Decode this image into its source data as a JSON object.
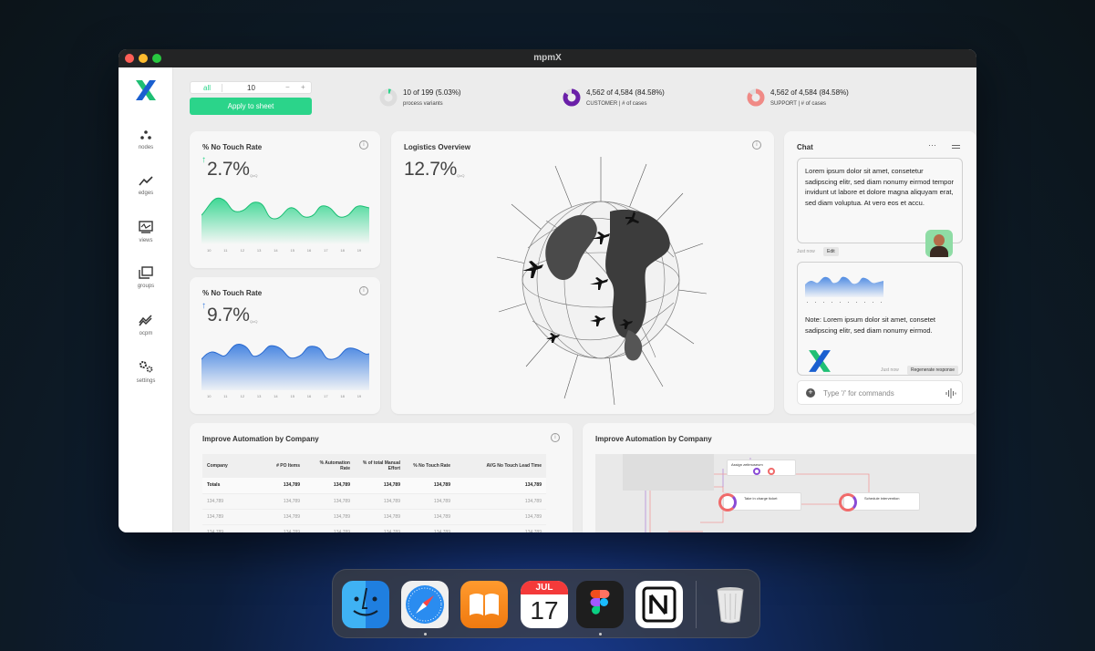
{
  "window": {
    "title": "mpmX"
  },
  "sidebar": {
    "items": [
      {
        "label": "nodes",
        "icon": "nodes-icon"
      },
      {
        "label": "edges",
        "icon": "edges-icon"
      },
      {
        "label": "views",
        "icon": "views-icon"
      },
      {
        "label": "groups",
        "icon": "groups-icon"
      },
      {
        "label": "ocpm",
        "icon": "ocpm-icon"
      },
      {
        "label": "settings",
        "icon": "settings-icon"
      }
    ]
  },
  "toolbar": {
    "all_label": "all",
    "count_value": "10",
    "minus": "−",
    "plus": "+",
    "apply_label": "Apply to sheet"
  },
  "stats": [
    {
      "line1": "10 of 199 (5.03%)",
      "line2": "process variants",
      "ring_color": "#2bd48a",
      "percent": 5.03
    },
    {
      "line1": "4,562 of 4,584 (84.58%)",
      "line2": "CUSTOMER | # of cases",
      "ring_color": "#6a1fa8",
      "percent": 84.58
    },
    {
      "line1": "4,562 of 4,584 (84.58%)",
      "line2": "SUPPORT | # of cases",
      "ring_color": "#f08a86",
      "percent": 84.58
    }
  ],
  "kpi_cards": [
    {
      "title": "% No Touch Rate",
      "value": "2.7%",
      "qoq": "QoQ",
      "color": "#2bd48a",
      "ticks": [
        "10",
        "11",
        "12",
        "13",
        "14",
        "15",
        "16",
        "17",
        "18",
        "19"
      ]
    },
    {
      "title": "% No Touch Rate",
      "value": "9.7%",
      "qoq": "QoQ",
      "color": "#3d7fe0",
      "ticks": [
        "10",
        "11",
        "12",
        "13",
        "14",
        "15",
        "16",
        "17",
        "18",
        "19"
      ]
    }
  ],
  "logistics": {
    "title": "Logistics Overview",
    "value": "12.7%",
    "qoq": "QoQ"
  },
  "chat": {
    "title": "Chat",
    "message1": "Lorem ipsum dolor sit amet, consetetur sadipscing elitr, sed diam nonumy eirmod tempor invidunt ut labore et dolore magna aliquyam erat, sed diam voluptua. At vero eos et accu.",
    "message1_time": "Just now",
    "edit_label": "Edit",
    "message2": "Note: Lorem ipsum dolor sit amet, consetet sadipscing elitr, sed diam nonumy eirmod.",
    "message2_time": "Just now",
    "regenerate_label": "Regenerate response",
    "input_placeholder": "Type '/' for commands"
  },
  "table_card": {
    "title": "Improve Automation by Company",
    "columns": [
      "Company",
      "# PO Items",
      "% Automation Rate",
      "% of total Manual Effort",
      "% No Touch Rate",
      "AVG No Touch Lead Time"
    ],
    "rows": [
      [
        "Totals",
        "134,789",
        "134,789",
        "134,789",
        "134,789",
        "134,789"
      ],
      [
        "134,789",
        "134,789",
        "134,789",
        "134,789",
        "134,789",
        "134,789"
      ],
      [
        "134,789",
        "134,789",
        "134,789",
        "134,789",
        "134,789",
        "134,789"
      ],
      [
        "134,789",
        "134,789",
        "134,789",
        "134,789",
        "134,789",
        "134,789"
      ]
    ]
  },
  "process_card": {
    "title": "Improve Automation by Company",
    "nodes": [
      "Assign zeitmuseum",
      "Take in charge ticket",
      "Schedule intervention"
    ]
  },
  "dock": {
    "apps": [
      "Finder",
      "Safari",
      "Books",
      "Calendar",
      "Figma",
      "Notion",
      "Trash"
    ],
    "calendar_month": "JUL",
    "calendar_day": "17"
  }
}
